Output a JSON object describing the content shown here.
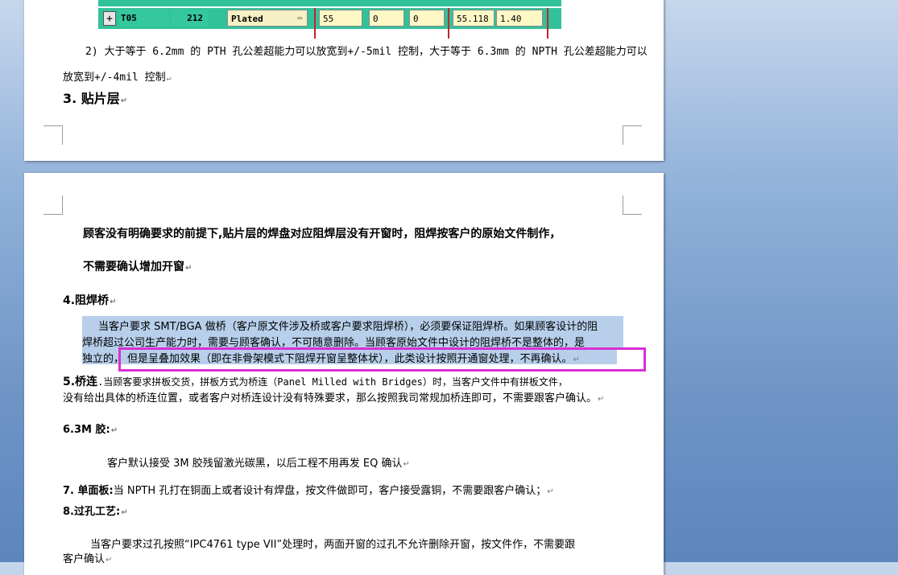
{
  "page1": {
    "table_row": {
      "expand_icon": "plus-box-icon",
      "id": "T05",
      "size": "212",
      "plating": "Plated",
      "values": [
        "55",
        "0",
        "0",
        "55.118",
        "1.40"
      ]
    },
    "para_2_line1": "2) 大于等于 6.2mm 的 PTH 孔公差超能力可以放宽到+/-5mil 控制，大于等于 6.3mm 的 NPTH 孔公差超能力可以",
    "para_2_line2": "放宽到+/-4mil 控制",
    "heading_3": "3.  贴片层"
  },
  "page2": {
    "para_a_line1": "顾客没有明确要求的前提下,贴片层的焊盘对应阻焊层没有开窗时，阻焊按客户的原始文件制作，",
    "para_a_line2": "不需要确认增加开窗",
    "heading_4": "4.阻焊桥",
    "p4_line1": "当客户要求 SMT/BGA 做桥（客户原文件涉及桥或客户要求阻焊桥），必须要保证阻焊桥。如果顾客设计的阻",
    "p4_line2": "焊桥超过公司生产能力时，需要与顾客确认，不可随意删除。当顾客原始文件中设计的阻焊桥不是整体的，是",
    "p4_line3a": "独立的，",
    "p4_line3b": "但是呈叠加效果（即在非骨架模式下阻焊开窗呈整体状），此类设计按照开通窗处理，不再确认。",
    "heading_5": "5.桥连",
    "p5_line1": ".当顾客要求拼板交货，拼板方式为桥连（Panel Milled with Bridges）时，当客户文件中有拼板文件，",
    "p5_line2": "没有给出具体的桥连位置，或者客户对桥连设计没有特殊要求，那么按照我司常规加桥连即可，不需要跟客户确认。",
    "heading_6": "6.3M 胶:",
    "p6": "客户默认接受 3M 胶残留激光碳黑，以后工程不用再发 EQ 确认",
    "heading_7": "7. 单面板:",
    "p7": "当 NPTH 孔打在铜面上或者设计有焊盘，按文件做即可，客户接受露铜，不需要跟客户确认；",
    "heading_8": "8.过孔工艺:",
    "p8_line1": "当客户要求过孔按照“IPC4761 type VII”处理时，两面开窗的过孔不允许删除开窗，按文件作，不需要跟",
    "p8_line2": "客户确认"
  },
  "colors": {
    "selection": "#b7cfea",
    "highlight_box": "#d82fd5",
    "table_green": "#32c29a",
    "table_yellow": "#fdf8c6"
  }
}
